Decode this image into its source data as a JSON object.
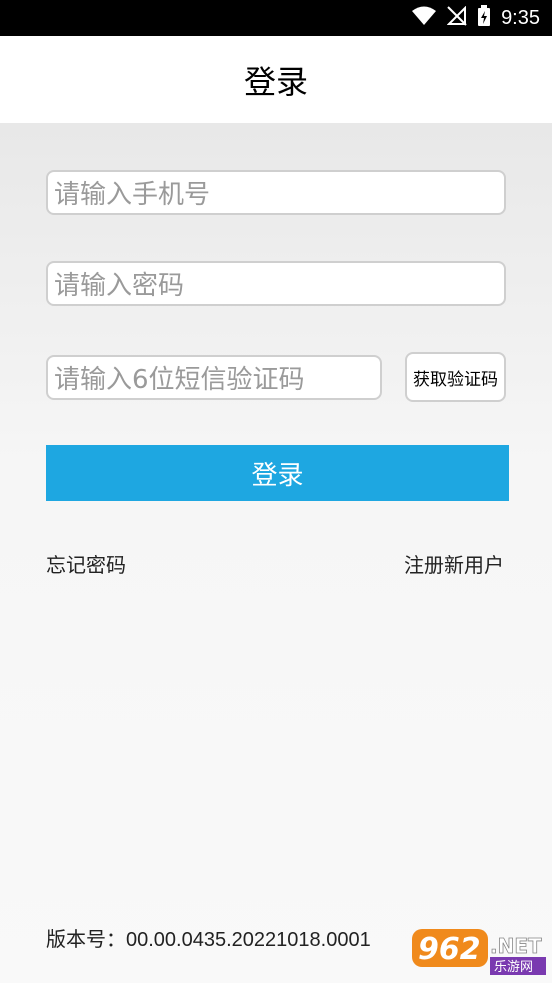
{
  "status_bar": {
    "time": "9:35"
  },
  "header": {
    "title": "登录"
  },
  "form": {
    "phone_placeholder": "请输入手机号",
    "password_placeholder": "请输入密码",
    "sms_placeholder": "请输入6位短信验证码",
    "get_code_label": "获取验证码",
    "login_label": "登录"
  },
  "links": {
    "forgot": "忘记密码",
    "register": "注册新用户"
  },
  "footer": {
    "version": "版本号：00.00.0435.20221018.0001"
  },
  "watermark": {
    "brand": "962.NET",
    "sub": "乐游网"
  },
  "colors": {
    "accent": "#1ea7e1",
    "status_bar": "#000000"
  },
  "icons": [
    "wifi-icon",
    "no-signal-icon",
    "battery-charging-icon"
  ]
}
